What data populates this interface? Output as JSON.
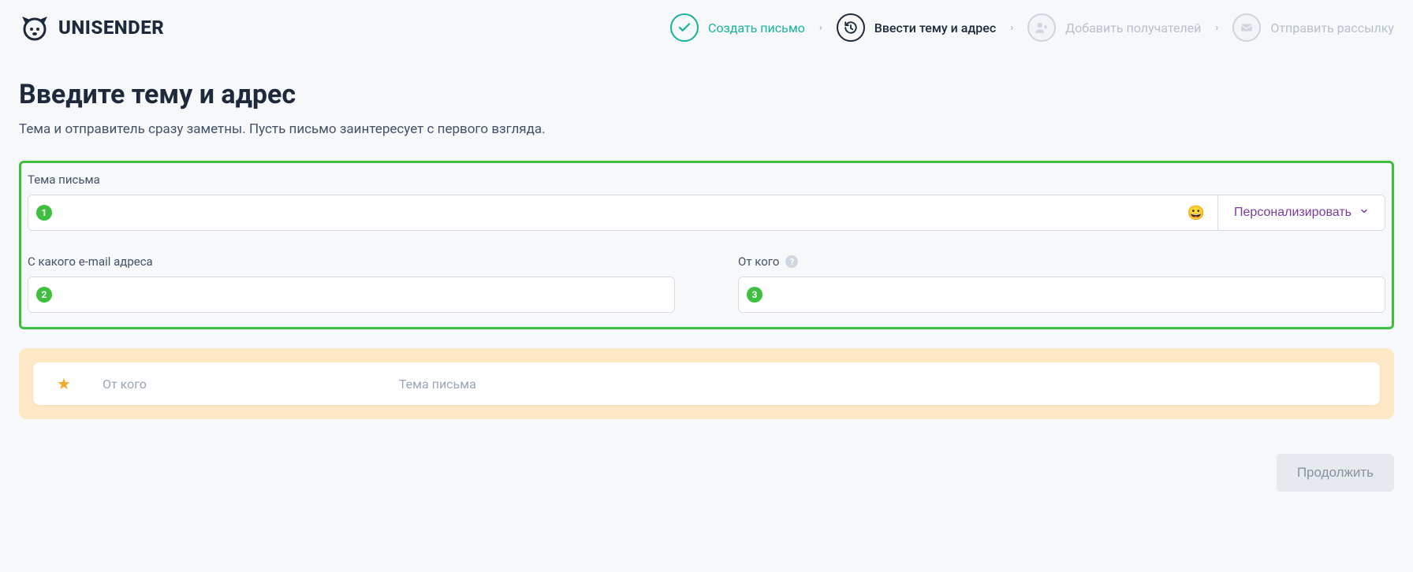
{
  "brand": {
    "name": "UNISENDER"
  },
  "stepper": {
    "steps": [
      {
        "label": "Создать письмо",
        "state": "done"
      },
      {
        "label": "Ввести тему и адрес",
        "state": "active"
      },
      {
        "label": "Добавить получателей",
        "state": "disabled"
      },
      {
        "label": "Отправить рассылку",
        "state": "disabled"
      }
    ]
  },
  "page": {
    "title": "Введите тему и адрес",
    "subtitle": "Тема и отправитель сразу заметны. Пусть письмо заинтересует с первого взгляда."
  },
  "fields": {
    "subject_label": "Тема письма",
    "subject_value": "",
    "emoji_icon": "😀",
    "personalize_label": "Персонализировать",
    "from_email_label": "С какого e-mail адреса",
    "from_email_value": "",
    "from_name_label": "От кого",
    "from_name_value": "",
    "help_icon": "?"
  },
  "badges": {
    "one": "1",
    "two": "2",
    "three": "3"
  },
  "preview": {
    "from_placeholder": "От кого",
    "subject_placeholder": "Тема письма"
  },
  "footer": {
    "continue_label": "Продолжить"
  }
}
